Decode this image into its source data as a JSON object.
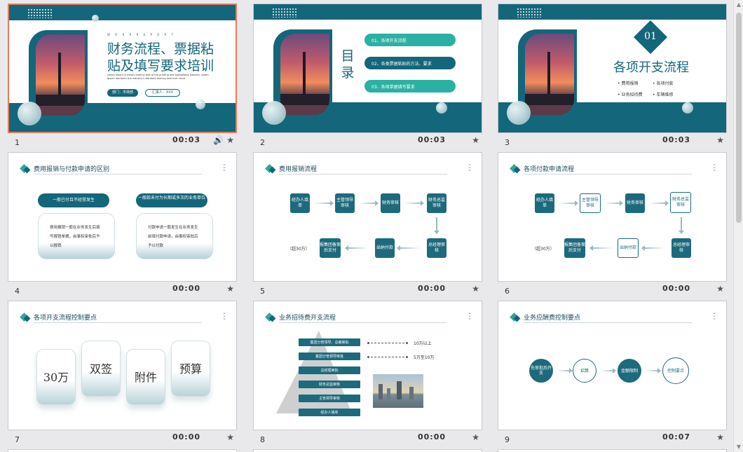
{
  "slides": [
    {
      "num": "1",
      "time": "00:03",
      "has_audio": true,
      "small_caps": "W O R K   R E P O R T",
      "title_line1": "财务流程、票据粘",
      "title_line2": "贴及填写要求培训",
      "blurb": "Lorem Ipsum is simply dummy text of the printing and typesetting industry. Lorem Ipsum has been the industry's standard dummy text ever since",
      "dept": "部门：市场部",
      "reporter": "汇报人：XXX"
    },
    {
      "num": "2",
      "time": "00:03",
      "toc_title": "目录",
      "items": [
        "01、各项开支流程",
        "02、各类票据粘贴的方法、要求",
        "03、各项单据填写要求"
      ]
    },
    {
      "num": "3",
      "time": "00:03",
      "badge": "01",
      "title": "各项开支流程",
      "bullets": [
        "费用报销",
        "各项付款",
        "业务招待费",
        "车辆维修"
      ]
    },
    {
      "num": "4",
      "time": "00:00",
      "title": "费用报销与付款申请的区别",
      "left_head": "一般已付且不经常发生",
      "left_body": "费用报销一般在业务发生后填写报销单据，由事权审批后予以报销",
      "right_head": "一般款未付为长期或多次的业务单位",
      "right_body": "付款申请一般发生在业务发生前填付款申请，由事权审批后予以付款"
    },
    {
      "num": "5",
      "time": "00:00",
      "title": "费用报销流程",
      "steps": [
        "经办人填单",
        "主管领导审核",
        "财务审核",
        "财务总监审核",
        "总经理审核",
        "出纳付款",
        "报集团备案后支付"
      ],
      "note": "（超30万）"
    },
    {
      "num": "6",
      "time": "00:00",
      "title": "各项付款申请流程",
      "steps": [
        "经办人填单",
        "主管领导审核",
        "财务审核",
        "财务总监审核",
        "总经理审核",
        "出纳付款",
        "报集团备案后支付"
      ],
      "note": "（超30万）"
    },
    {
      "num": "7",
      "time": "00:00",
      "title": "各项开支流程控制要点",
      "cards": [
        "30万",
        "双签",
        "附件",
        "预算"
      ]
    },
    {
      "num": "8",
      "time": "00:00",
      "title": "业务招待费开支流程",
      "tiers": [
        "集团分管领导、总裁审批",
        "集团分管领导审批",
        "总经理审批",
        "财务总监审核",
        "主管领导审核",
        "经办人填单"
      ],
      "limits": [
        "10万以上",
        "5万至10万"
      ]
    },
    {
      "num": "9",
      "time": "00:07",
      "title": "业务应酬费控制要点",
      "circles": [
        "先审批后开支",
        "招算",
        "金额限制",
        "控制要点"
      ]
    }
  ]
}
